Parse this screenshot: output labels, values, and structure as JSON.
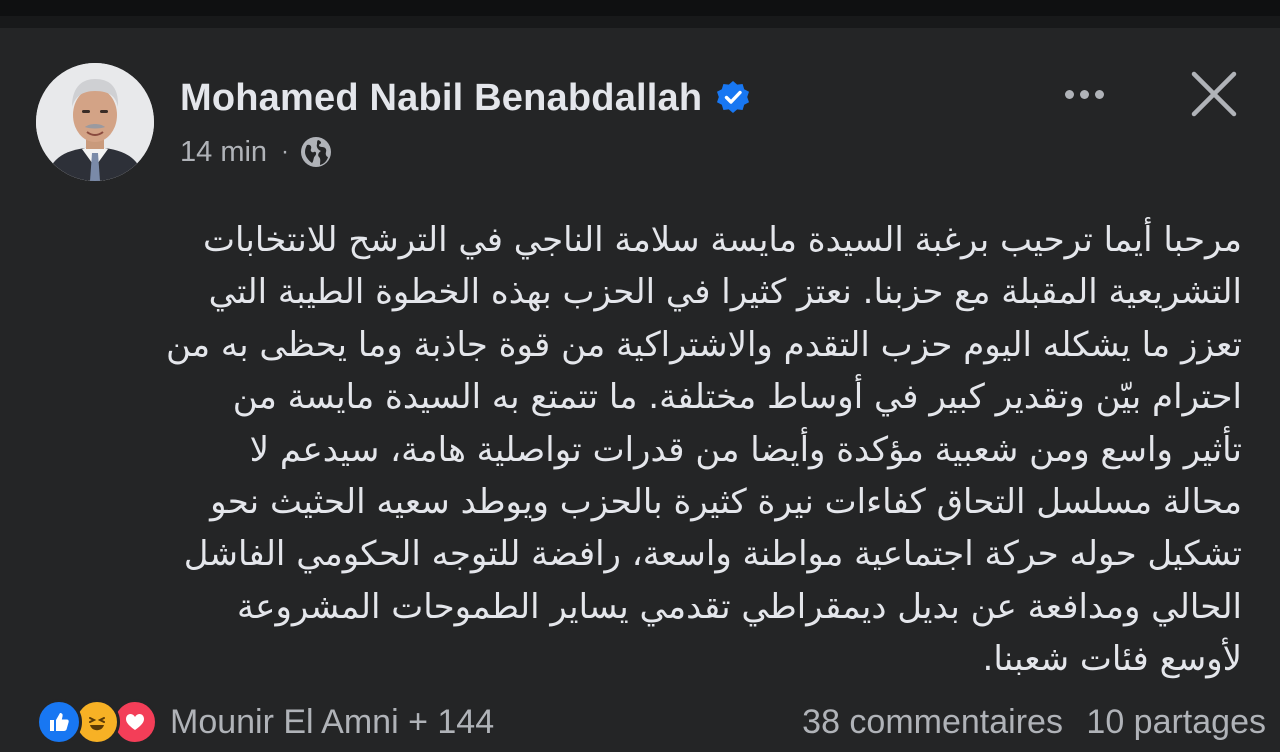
{
  "post": {
    "author": "Mohamed Nabil Benabdallah",
    "timestamp": "14 min",
    "separator": "·",
    "body_lines": [
      "مرحبا أيما ترحيب برغبة السيدة مايسة سلامة الناجي في الترشح للانتخابات",
      "التشريعية المقبلة مع حزبنا. نعتز كثيرا في الحزب بهذه الخطوة الطيبة التي",
      "تعزز ما يشكله اليوم حزب التقدم والاشتراكية من قوة جاذبة وما يحظى به من",
      "احترام بيّن وتقدير كبير في أوساط مختلفة. ما تتمتع به السيدة مايسة من",
      "تأثير واسع ومن شعبية مؤكدة  وأيضا من قدرات تواصلية هامة، سيدعم لا",
      "محالة مسلسل التحاق كفاءات نيرة كثيرة بالحزب ويوطد سعيه الحثيث نحو",
      "تشكيل حوله حركة اجتماعية مواطنة واسعة، رافضة للتوجه الحكومي الفاشل",
      "الحالي ومدافعة عن بديل ديمقراطي تقدمي يساير الطموحات المشروعة",
      "لأوسع فئات شعبنا."
    ]
  },
  "reactions": {
    "names": "Mounir El Amni + 144",
    "comments": "38 commentaires",
    "shares": "10 partages"
  },
  "icons": {
    "verified": "verified-badge-icon",
    "audience": "globe-icon",
    "more": "more-options-icon",
    "close": "close-icon",
    "like": "like-reaction-icon",
    "haha": "haha-reaction-icon",
    "love": "love-reaction-icon"
  },
  "colors": {
    "background": "#242526",
    "primary_text": "#e4e6eb",
    "secondary_text": "#b0b3b8",
    "verified_blue": "#1877f2"
  }
}
